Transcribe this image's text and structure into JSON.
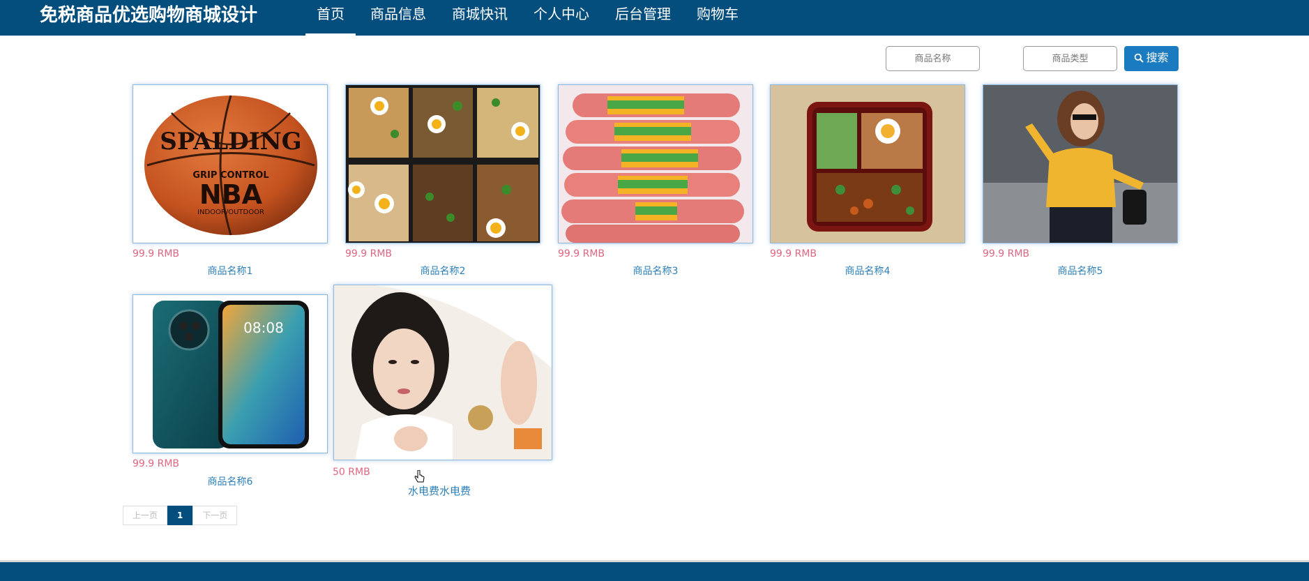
{
  "header": {
    "site_title": "免税商品优选购物商城设计",
    "nav": [
      {
        "label": "首页",
        "active": true
      },
      {
        "label": "商品信息"
      },
      {
        "label": "商城快讯"
      },
      {
        "label": "个人中心"
      },
      {
        "label": "后台管理"
      },
      {
        "label": "购物车"
      }
    ]
  },
  "search": {
    "name_placeholder": "商品名称",
    "type_placeholder": "商品类型",
    "button_label": "搜索"
  },
  "products": [
    {
      "price": "99.9 RMB",
      "name": "商品名称1",
      "image": "spalding-nba-basketball"
    },
    {
      "price": "99.9 RMB",
      "name": "商品名称2",
      "image": "noodle-bento-boxes"
    },
    {
      "price": "99.9 RMB",
      "name": "商品名称3",
      "image": "ham-sausages"
    },
    {
      "price": "99.9 RMB",
      "name": "商品名称4",
      "image": "bento-lunch-box"
    },
    {
      "price": "99.9 RMB",
      "name": "商品名称5",
      "image": "woman-yellow-sweater"
    },
    {
      "price": "99.9 RMB",
      "name": "商品名称6",
      "image": "huawei-smartphone"
    },
    {
      "price": "50 RMB",
      "name": "水电费水电费",
      "image": "woman-portrait-costume"
    }
  ],
  "pagination": {
    "prev_label": "上一页",
    "current_page": "1",
    "next_label": "下一页"
  },
  "colors": {
    "brand_navy": "#044e7e",
    "search_blue": "#1a7bc0",
    "price_pink": "#e0667f",
    "name_blue": "#2d7fb8"
  }
}
